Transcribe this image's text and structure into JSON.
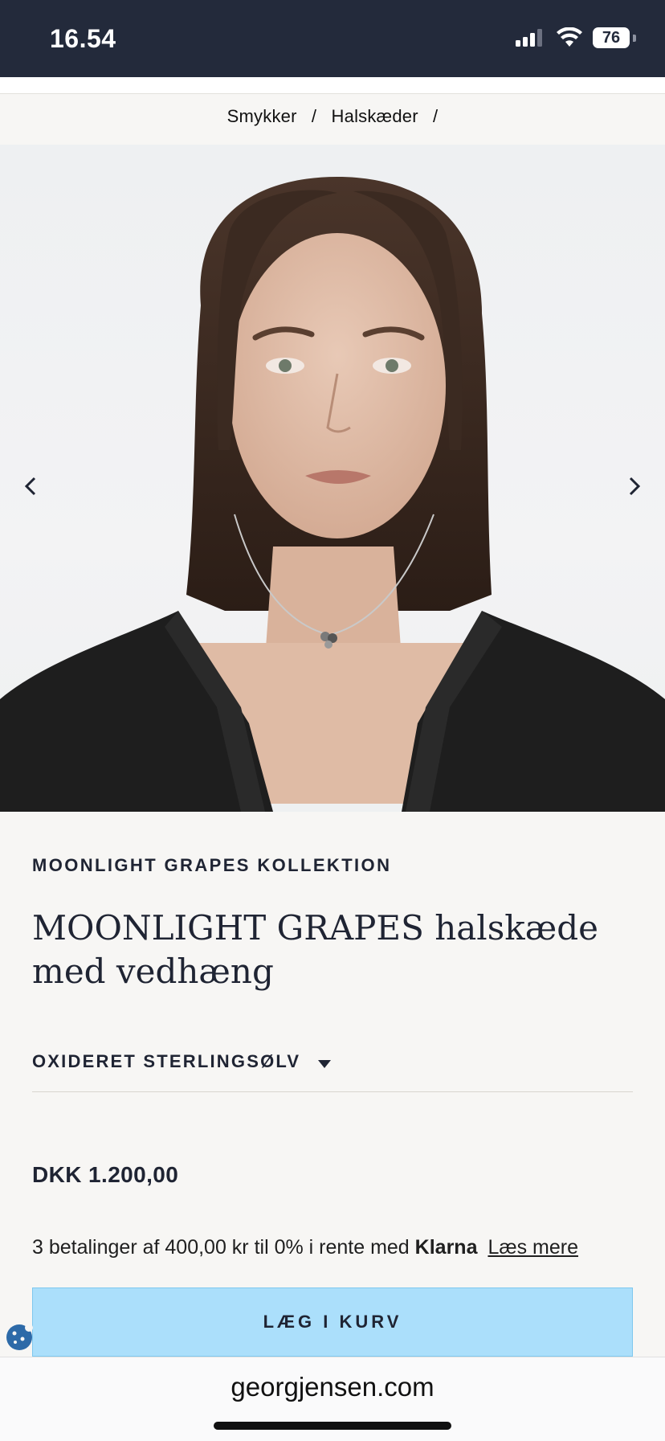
{
  "status_bar": {
    "time": "16.54",
    "battery": "76",
    "icons": [
      "cellular-signal-icon",
      "wifi-icon",
      "battery-icon"
    ]
  },
  "breadcrumb": {
    "items": [
      "Smykker",
      "Halskæder"
    ],
    "separator": "/"
  },
  "hero": {
    "image": "model-wearing-necklace",
    "prev_icon": "chevron-left-icon",
    "next_icon": "chevron-right-icon"
  },
  "product": {
    "collection": "MOONLIGHT GRAPES KOLLEKTION",
    "title": "MOONLIGHT GRAPES halskæde med vedhæng",
    "variant": "OXIDERET STERLINGSØLV",
    "price": "DKK 1.200,00",
    "klarna_text": "3 betalinger af 400,00 kr til 0% i rente med",
    "klarna_brand": "Klarna",
    "klarna_link": "Læs mere",
    "add_to_cart": "LÆG I KURV"
  },
  "browser": {
    "url": "georgjensen.com"
  },
  "colors": {
    "status_bar": "#232a3b",
    "button_bg": "#abdffb",
    "text": "#1f2433",
    "page_bg": "#f7f6f4"
  }
}
